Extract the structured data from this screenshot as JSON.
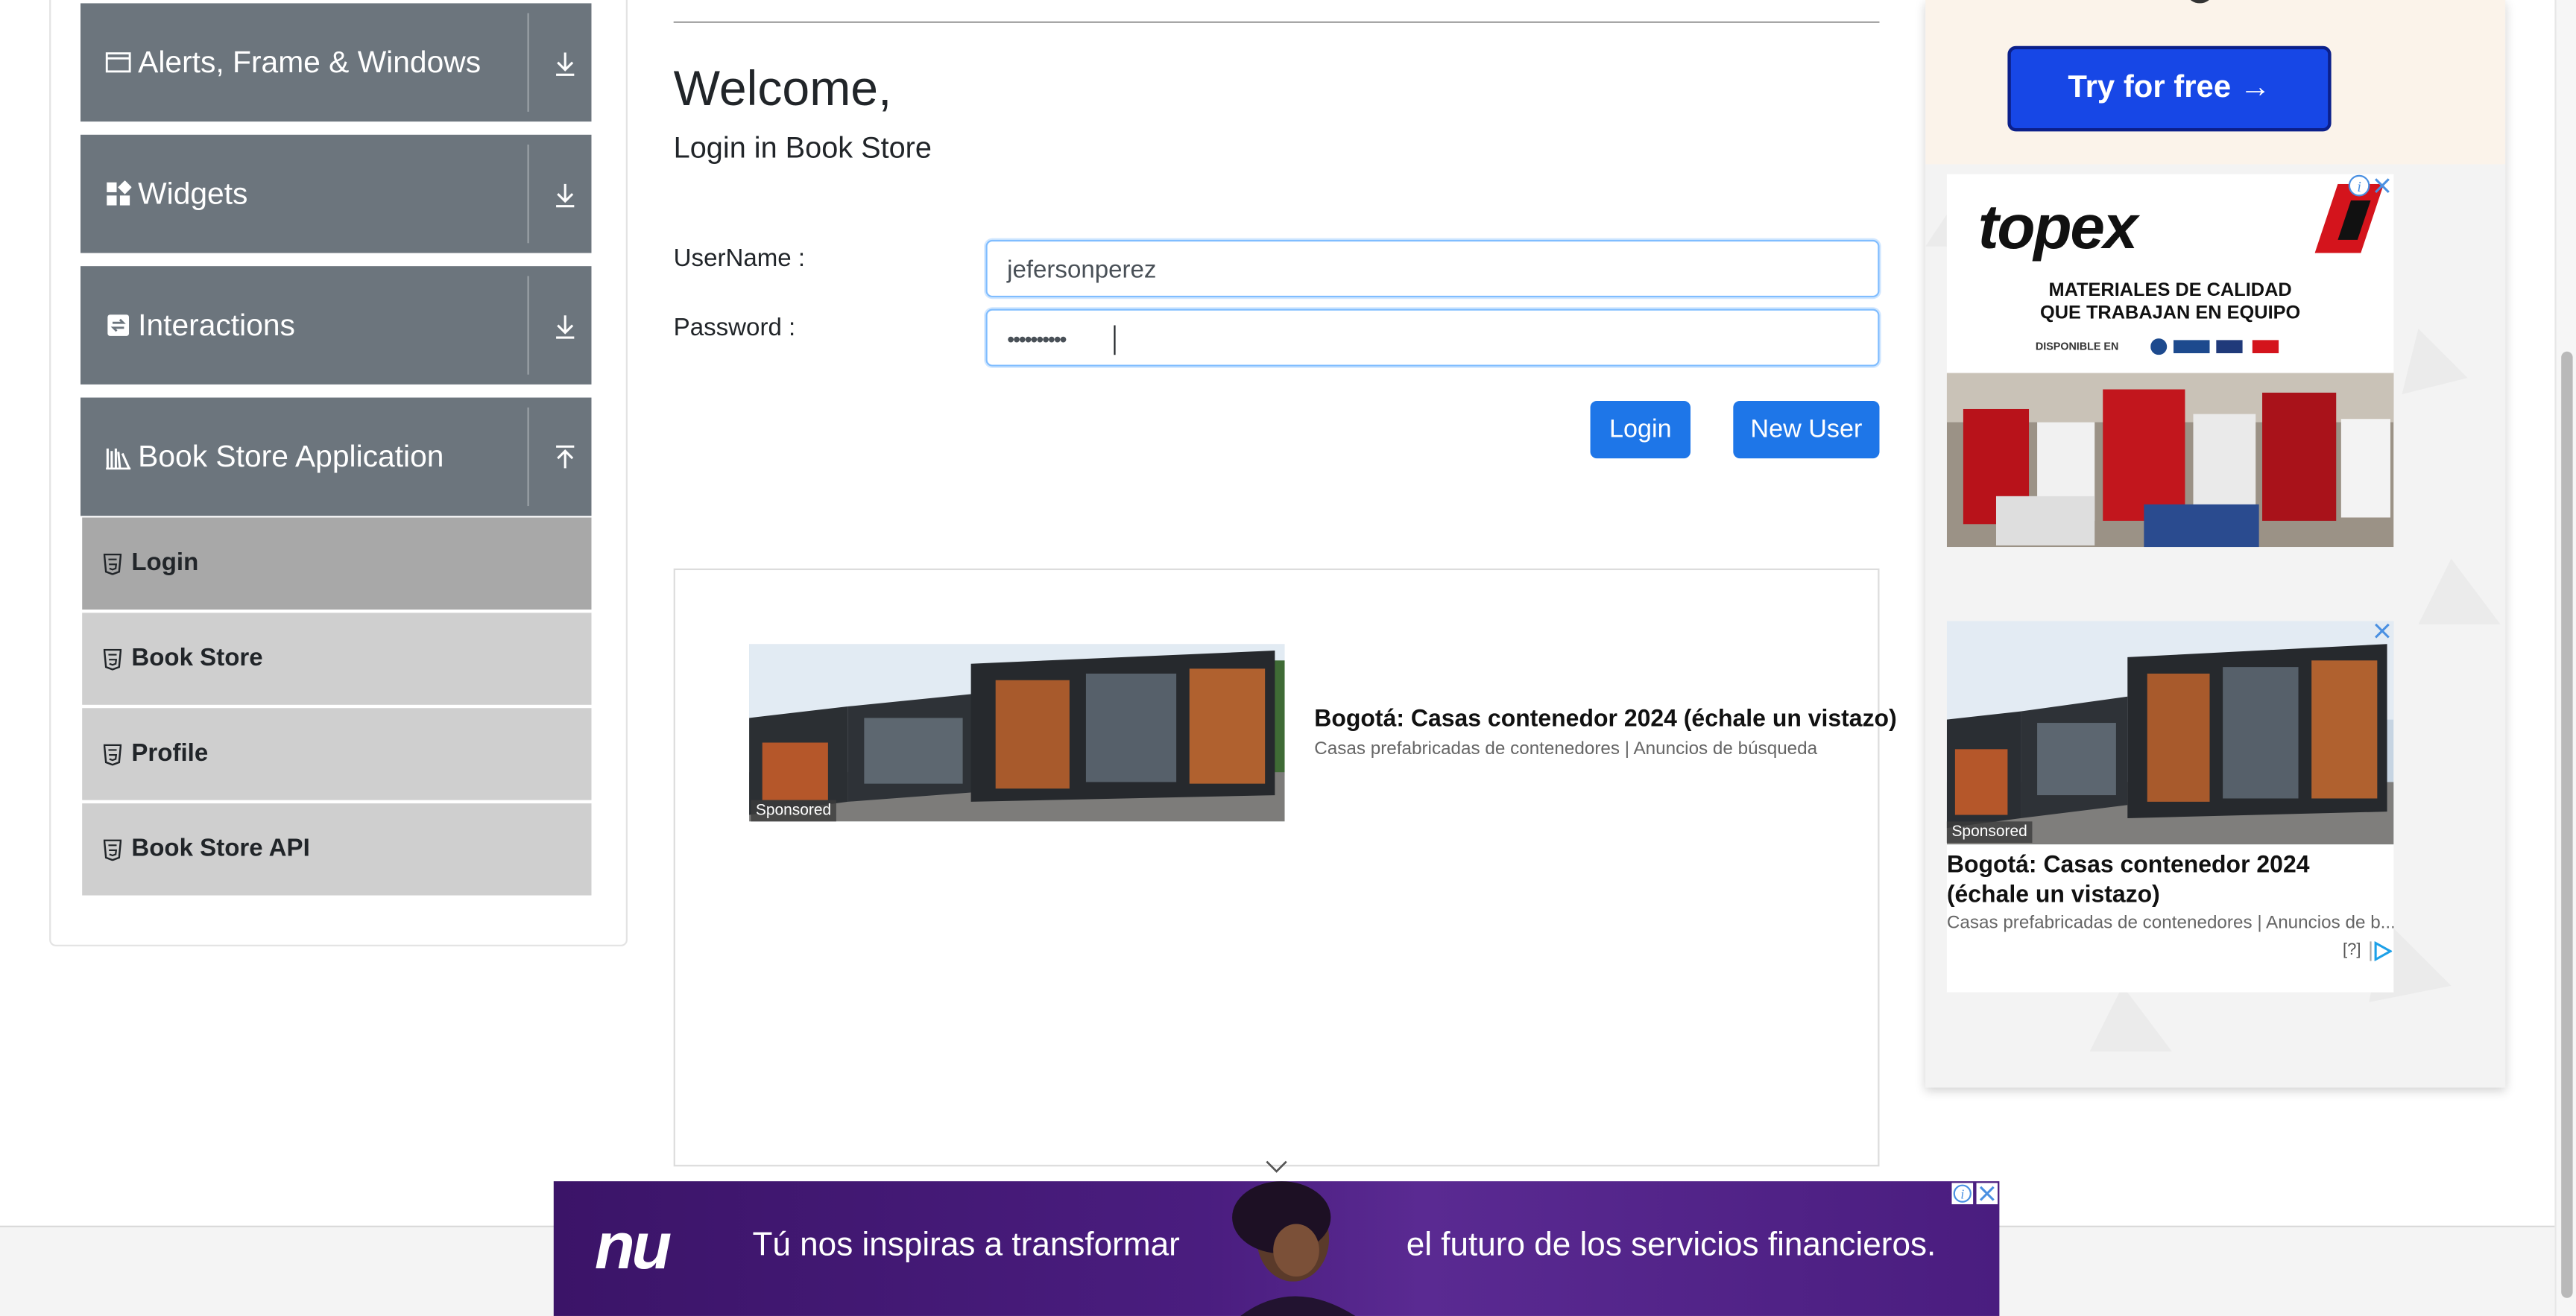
{
  "sidebar": {
    "groups": [
      {
        "label": "Alerts, Frame & Windows"
      },
      {
        "label": "Widgets"
      },
      {
        "label": "Interactions"
      },
      {
        "label": "Book Store Application"
      }
    ],
    "items": [
      {
        "label": "Login"
      },
      {
        "label": "Book Store"
      },
      {
        "label": "Profile"
      },
      {
        "label": "Book Store API"
      }
    ]
  },
  "main": {
    "welcome": "Welcome,",
    "subtitle": "Login in Book Store",
    "username_label": "UserName :",
    "username_value": "jefersonperez",
    "password_label": "Password :",
    "password_masked": "••••••••••",
    "login_button": "Login",
    "new_user_button": "New User"
  },
  "inline_ad": {
    "sponsored": "Sponsored",
    "title": "Bogotá: Casas contenedor 2024 (échale un vistazo)",
    "subtitle": "Casas prefabricadas de contenedores | Anuncios de búsqueda"
  },
  "right_ads": {
    "try_button": "Try for free →",
    "topex_brand": "topex",
    "topex_line1": "MATERIALES DE CALIDAD",
    "topex_line2": "QUE TRABAJAN EN EQUIPO",
    "topex_line3": "DISPONIBLE EN",
    "card_sponsored": "Sponsored",
    "card_title": "Bogotá: Casas contenedor 2024 (échale un vistazo)",
    "card_sub": "Casas prefabricadas de contenedores | Anuncios de b...",
    "card_info": "[?]"
  },
  "bottom_ad": {
    "brand": "nu",
    "text_left": "Tú nos inspiras a transformar",
    "text_right": "el futuro de los servicios financieros."
  },
  "colors": {
    "accordion_bg": "#6c757d",
    "item_bg": "#cfcfcf",
    "item_active_bg": "#a8a8a8",
    "primary_button": "#1e76e8",
    "try_button": "#1747e6",
    "topex_red": "#d4141c",
    "bottom_ad_purple": "#4a1d7f"
  },
  "icons": [
    "window-icon",
    "grid-icon",
    "interactions-icon",
    "books-icon",
    "download-arrow-icon",
    "upload-arrow-icon",
    "html5-icon",
    "close-icon",
    "info-icon",
    "chevron-down-icon"
  ]
}
